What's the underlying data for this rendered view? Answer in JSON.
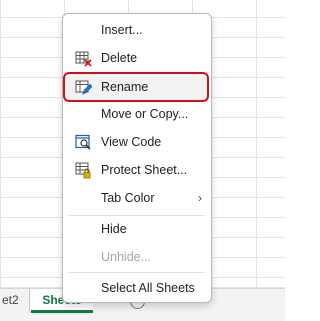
{
  "sheet_tabs": [
    {
      "label": "et2"
    },
    {
      "label": "Sheet3"
    }
  ],
  "context_menu": {
    "items": [
      {
        "label": "Insert...",
        "icon": null,
        "enabled": true
      },
      {
        "label": "Delete",
        "icon": "delete-sheet-icon",
        "enabled": true
      },
      {
        "label": "Rename",
        "icon": "rename-sheet-icon",
        "enabled": true,
        "highlighted": true
      },
      {
        "label": "Move or Copy...",
        "icon": null,
        "enabled": true
      },
      {
        "label": "View Code",
        "icon": "view-code-icon",
        "enabled": true
      },
      {
        "label": "Protect Sheet...",
        "icon": "protect-sheet-icon",
        "enabled": true
      },
      {
        "label": "Tab Color",
        "icon": null,
        "enabled": true,
        "submenu": true
      },
      {
        "label": "Hide",
        "icon": null,
        "enabled": true
      },
      {
        "label": "Unhide...",
        "icon": null,
        "enabled": false
      },
      {
        "label": "Select All Sheets",
        "icon": null,
        "enabled": true
      }
    ]
  },
  "colors": {
    "highlight_border": "#d0101e",
    "active_tab": "#107c41"
  }
}
